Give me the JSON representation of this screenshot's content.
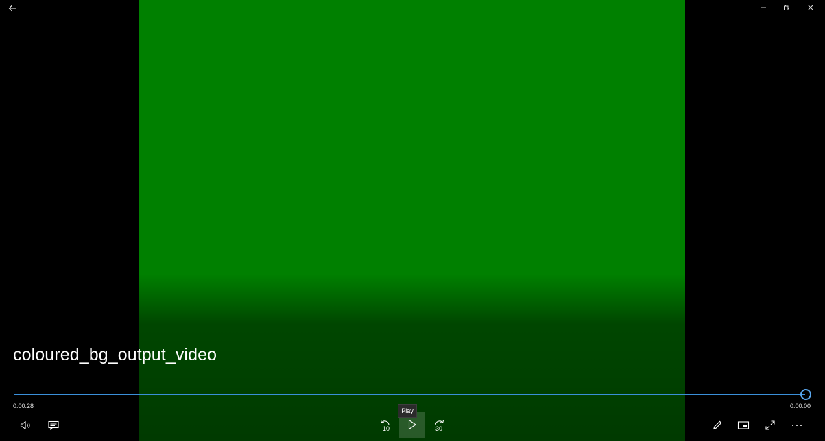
{
  "window": {
    "back_icon": "arrow-left-icon",
    "minimize_icon": "minimize-icon",
    "restore_icon": "restore-icon",
    "close_icon": "close-icon"
  },
  "video": {
    "title": "coloured_bg_output_video",
    "frame_color": "#008000",
    "background_color": "#000000"
  },
  "seekbar": {
    "elapsed": "0:00:28",
    "remaining": "0:00:00",
    "progress": 1.0,
    "accent_color": "#3a8fd9"
  },
  "controls": {
    "volume_icon": "volume-icon",
    "captions_icon": "captions-icon",
    "skip_back_label": "10",
    "skip_back_icon": "skip-back-icon",
    "play_icon": "play-icon",
    "play_tooltip": "Play",
    "skip_forward_label": "30",
    "skip_forward_icon": "skip-forward-icon",
    "edit_icon": "pencil-icon",
    "miniview_icon": "mini-view-icon",
    "fullscreen_icon": "fullscreen-icon",
    "more_icon": "more-icon"
  }
}
